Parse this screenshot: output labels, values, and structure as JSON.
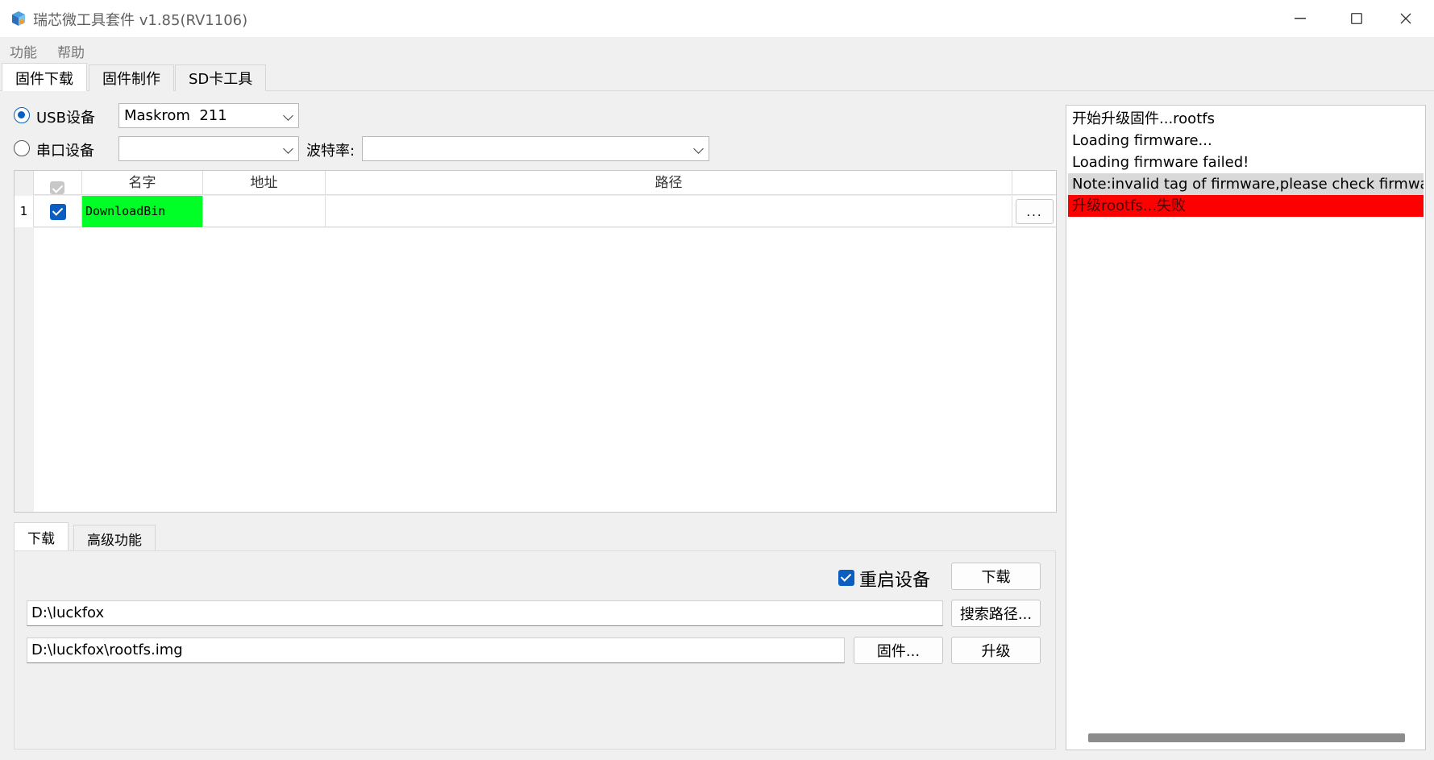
{
  "window": {
    "title": "瑞芯微工具套件 v1.85(RV1106)",
    "controls": {
      "minimize": "—",
      "maximize": "☐",
      "close": "✕"
    }
  },
  "menu": [
    "功能",
    "帮助"
  ],
  "tabs": [
    "固件下载",
    "固件制作",
    "SD卡工具"
  ],
  "device": {
    "usb_label": "USB设备",
    "usb_value": "Maskrom  211",
    "serial_label": "串口设备",
    "serial_value": "",
    "baud_label": "波特率:",
    "baud_value": ""
  },
  "table": {
    "headers": [
      "名字",
      "地址",
      "路径"
    ],
    "rows": [
      {
        "index": "1",
        "checked": true,
        "name": "DownloadBin",
        "address": "",
        "path": "",
        "browse": "..."
      }
    ]
  },
  "bottom": {
    "tabs": [
      "下载",
      "高级功能"
    ],
    "reboot_label": "重启设备",
    "download_btn": "下载",
    "search_path_btn": "搜索路径...",
    "folder_path": "D:\\luckfox",
    "firmware_path": "D:\\luckfox\\rootfs.img",
    "firmware_btn": "固件...",
    "upgrade_btn": "升级"
  },
  "log": [
    {
      "text": "开始升级固件...rootfs",
      "style": "normal"
    },
    {
      "text": "Loading firmware...",
      "style": "normal"
    },
    {
      "text": "Loading firmware failed!",
      "style": "normal"
    },
    {
      "text": "Note:invalid tag of firmware,please check firmware",
      "style": "highlight"
    },
    {
      "text": "升级rootfs...失败",
      "style": "error"
    }
  ],
  "colors": {
    "accent": "#0a5ec2",
    "name_cell": "#00ff26",
    "log_highlight": "#d9d9d9",
    "log_error": "#ff0000",
    "panel": "#f0f0f0"
  }
}
